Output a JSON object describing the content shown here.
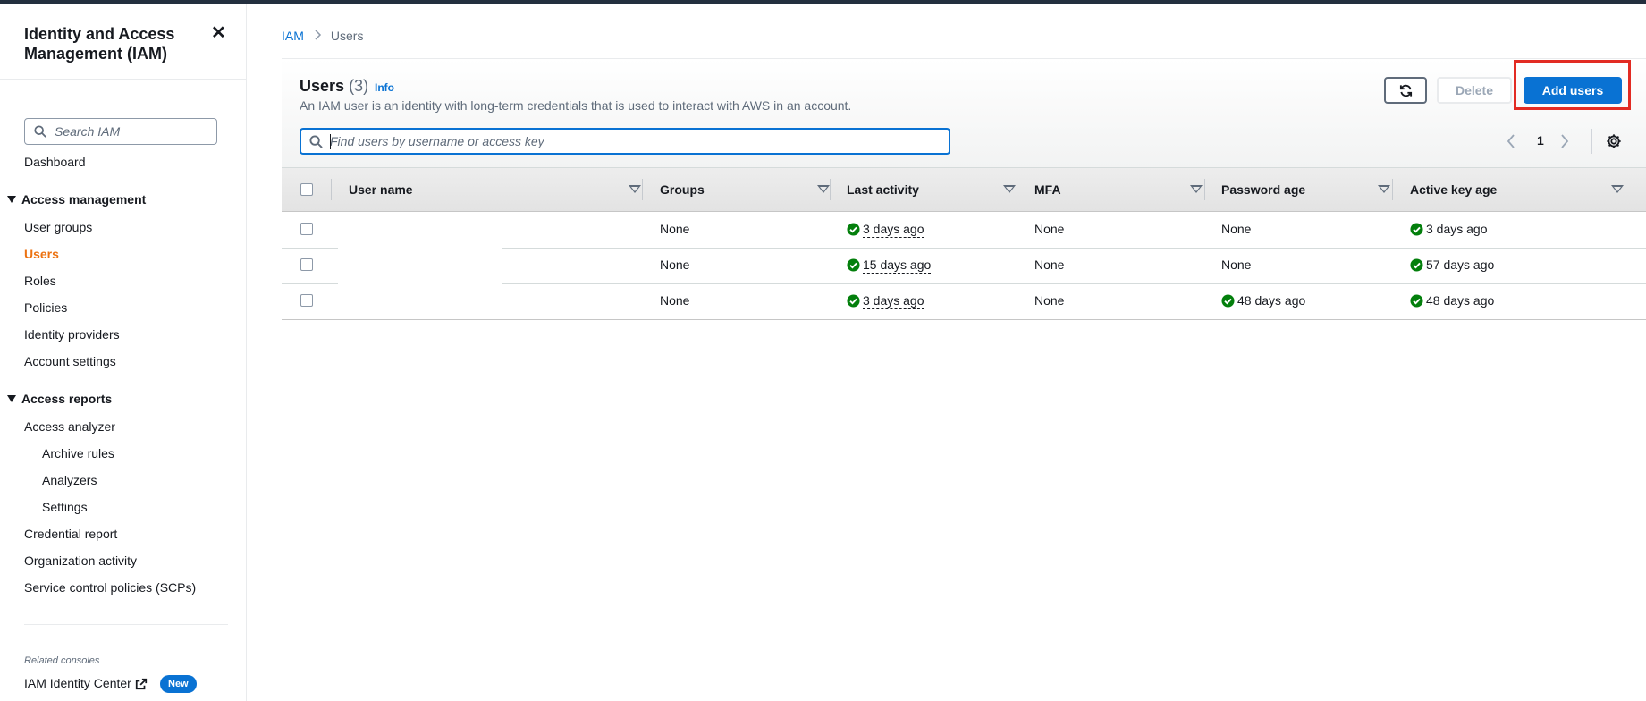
{
  "sidebar": {
    "title": "Identity and Access Management (IAM)",
    "search_placeholder": "Search IAM",
    "dashboard": "Dashboard",
    "access_management": {
      "label": "Access management",
      "items": [
        "User groups",
        "Users",
        "Roles",
        "Policies",
        "Identity providers",
        "Account settings"
      ]
    },
    "access_reports": {
      "label": "Access reports",
      "analyzer": "Access analyzer",
      "analyzer_items": [
        "Archive rules",
        "Analyzers",
        "Settings"
      ],
      "items": [
        "Credential report",
        "Organization activity",
        "Service control policies (SCPs)"
      ]
    },
    "related_label": "Related consoles",
    "identity_center": "IAM Identity Center",
    "new_badge": "New"
  },
  "breadcrumb": {
    "root": "IAM",
    "current": "Users"
  },
  "header": {
    "title": "Users",
    "count": "(3)",
    "info": "Info",
    "description": "An IAM user is an identity with long-term credentials that is used to interact with AWS in an account.",
    "delete_label": "Delete",
    "add_label": "Add users"
  },
  "filter": {
    "placeholder": "Find users by username or access key"
  },
  "pagination": {
    "page": "1"
  },
  "table": {
    "columns": [
      "User name",
      "Groups",
      "Last activity",
      "MFA",
      "Password age",
      "Active key age"
    ],
    "rows": [
      {
        "user": "",
        "groups": "None",
        "last_activity": "3 days ago",
        "mfa": "None",
        "password_age": "None",
        "key_age": "3 days ago"
      },
      {
        "user": "",
        "groups": "None",
        "last_activity": "15 days ago",
        "mfa": "None",
        "password_age": "None",
        "key_age": "57 days ago"
      },
      {
        "user": "",
        "groups": "None",
        "last_activity": "3 days ago",
        "mfa": "None",
        "password_age": "48 days ago",
        "key_age": "48 days ago"
      }
    ]
  },
  "colors": {
    "primary": "#0972d3",
    "active_nav": "#ec7211",
    "success": "#037f0c",
    "highlight": "#e22b23"
  }
}
